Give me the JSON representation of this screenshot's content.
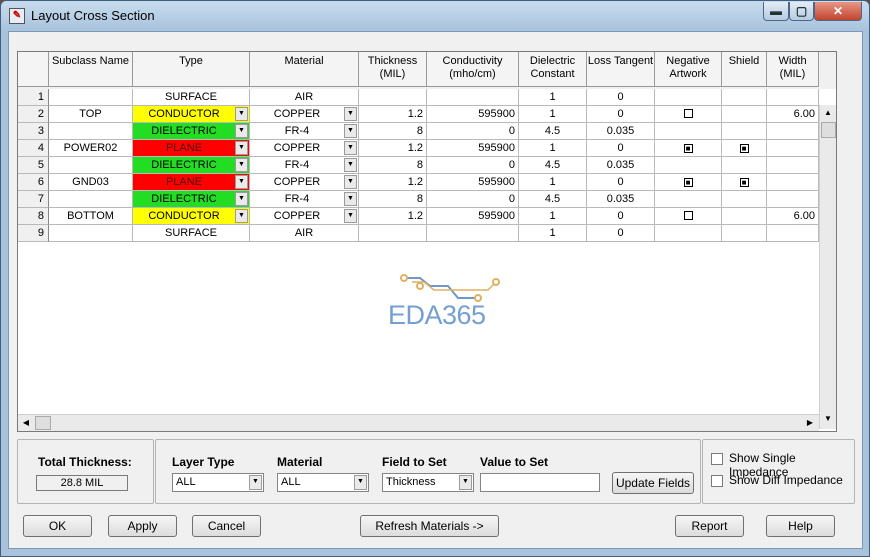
{
  "window": {
    "title": "Layout Cross Section",
    "min_glyph": "▬",
    "max_glyph": "▢",
    "close_glyph": "✕"
  },
  "grid": {
    "columns": [
      {
        "label": "Subclass Name"
      },
      {
        "label": "Type"
      },
      {
        "label": "Material"
      },
      {
        "label": "Thickness (MIL)"
      },
      {
        "label": "Conductivity (mho/cm)"
      },
      {
        "label": "Dielectric Constant"
      },
      {
        "label": "Loss Tangent"
      },
      {
        "label": "Negative Artwork"
      },
      {
        "label": "Shield"
      },
      {
        "label": "Width (MIL)"
      }
    ],
    "rows": [
      {
        "num": "1",
        "subclass": "",
        "type": "SURFACE",
        "type_color": "#ffffff",
        "type_text_color": "#000000",
        "type_dd": false,
        "material": "AIR",
        "mat_dd": false,
        "thickness": "",
        "conductivity": "",
        "dielectric": "1",
        "loss": "0",
        "neg": "",
        "shield": "",
        "width": ""
      },
      {
        "num": "2",
        "subclass": "TOP",
        "type": "CONDUCTOR",
        "type_color": "#ffff00",
        "type_text_color": "#000000",
        "type_dd": true,
        "material": "COPPER",
        "mat_dd": true,
        "thickness": "1.2",
        "conductivity": "595900",
        "dielectric": "1",
        "loss": "0",
        "neg": "unchecked",
        "shield": "",
        "width": "6.00"
      },
      {
        "num": "3",
        "subclass": "",
        "type": "DIELECTRIC",
        "type_color": "#22dd22",
        "type_text_color": "#000000",
        "type_dd": true,
        "material": "FR-4",
        "mat_dd": true,
        "thickness": "8",
        "conductivity": "0",
        "dielectric": "4.5",
        "loss": "0.035",
        "neg": "",
        "shield": "",
        "width": ""
      },
      {
        "num": "4",
        "subclass": "POWER02",
        "type": "PLANE",
        "type_color": "#ff0000",
        "type_text_color": "#4a1010",
        "type_dd": true,
        "material": "COPPER",
        "mat_dd": true,
        "thickness": "1.2",
        "conductivity": "595900",
        "dielectric": "1",
        "loss": "0",
        "neg": "checked",
        "shield": "checked",
        "width": ""
      },
      {
        "num": "5",
        "subclass": "",
        "type": "DIELECTRIC",
        "type_color": "#22dd22",
        "type_text_color": "#000000",
        "type_dd": true,
        "material": "FR-4",
        "mat_dd": true,
        "thickness": "8",
        "conductivity": "0",
        "dielectric": "4.5",
        "loss": "0.035",
        "neg": "",
        "shield": "",
        "width": ""
      },
      {
        "num": "6",
        "subclass": "GND03",
        "type": "PLANE",
        "type_color": "#ff0000",
        "type_text_color": "#4a1010",
        "type_dd": true,
        "material": "COPPER",
        "mat_dd": true,
        "thickness": "1.2",
        "conductivity": "595900",
        "dielectric": "1",
        "loss": "0",
        "neg": "checked",
        "shield": "checked",
        "width": ""
      },
      {
        "num": "7",
        "subclass": "",
        "type": "DIELECTRIC",
        "type_color": "#22dd22",
        "type_text_color": "#000000",
        "type_dd": true,
        "material": "FR-4",
        "mat_dd": true,
        "thickness": "8",
        "conductivity": "0",
        "dielectric": "4.5",
        "loss": "0.035",
        "neg": "",
        "shield": "",
        "width": ""
      },
      {
        "num": "8",
        "subclass": "BOTTOM",
        "type": "CONDUCTOR",
        "type_color": "#ffff00",
        "type_text_color": "#000000",
        "type_dd": true,
        "material": "COPPER",
        "mat_dd": true,
        "thickness": "1.2",
        "conductivity": "595900",
        "dielectric": "1",
        "loss": "0",
        "neg": "unchecked",
        "shield": "",
        "width": "6.00"
      },
      {
        "num": "9",
        "subclass": "",
        "type": "SURFACE",
        "type_color": "#ffffff",
        "type_text_color": "#000000",
        "type_dd": false,
        "material": "AIR",
        "mat_dd": false,
        "thickness": "",
        "conductivity": "",
        "dielectric": "1",
        "loss": "0",
        "neg": "",
        "shield": "",
        "width": ""
      }
    ]
  },
  "watermark": {
    "text": "EDA365"
  },
  "total_thickness": {
    "label": "Total Thickness:",
    "value": "28.8 MIL"
  },
  "field_set": {
    "layer_type_label": "Layer Type",
    "layer_type_value": "ALL",
    "material_label": "Material",
    "material_value": "ALL",
    "field_label": "Field to Set",
    "field_value": "Thickness",
    "value_label": "Value to Set",
    "value_value": "",
    "update_button": "Update Fields"
  },
  "impedance": {
    "single_label": "Show Single Impedance",
    "single_checked": false,
    "diff_label": "Show Diff Impedance",
    "diff_checked": false
  },
  "buttons": {
    "ok": "OK",
    "apply": "Apply",
    "cancel": "Cancel",
    "refresh": "Refresh Materials ->",
    "report": "Report",
    "help": "Help"
  },
  "colors": {
    "conductor": "#ffff00",
    "dielectric": "#22dd22",
    "plane": "#ff0000",
    "watermark": "#5b8fcc"
  }
}
